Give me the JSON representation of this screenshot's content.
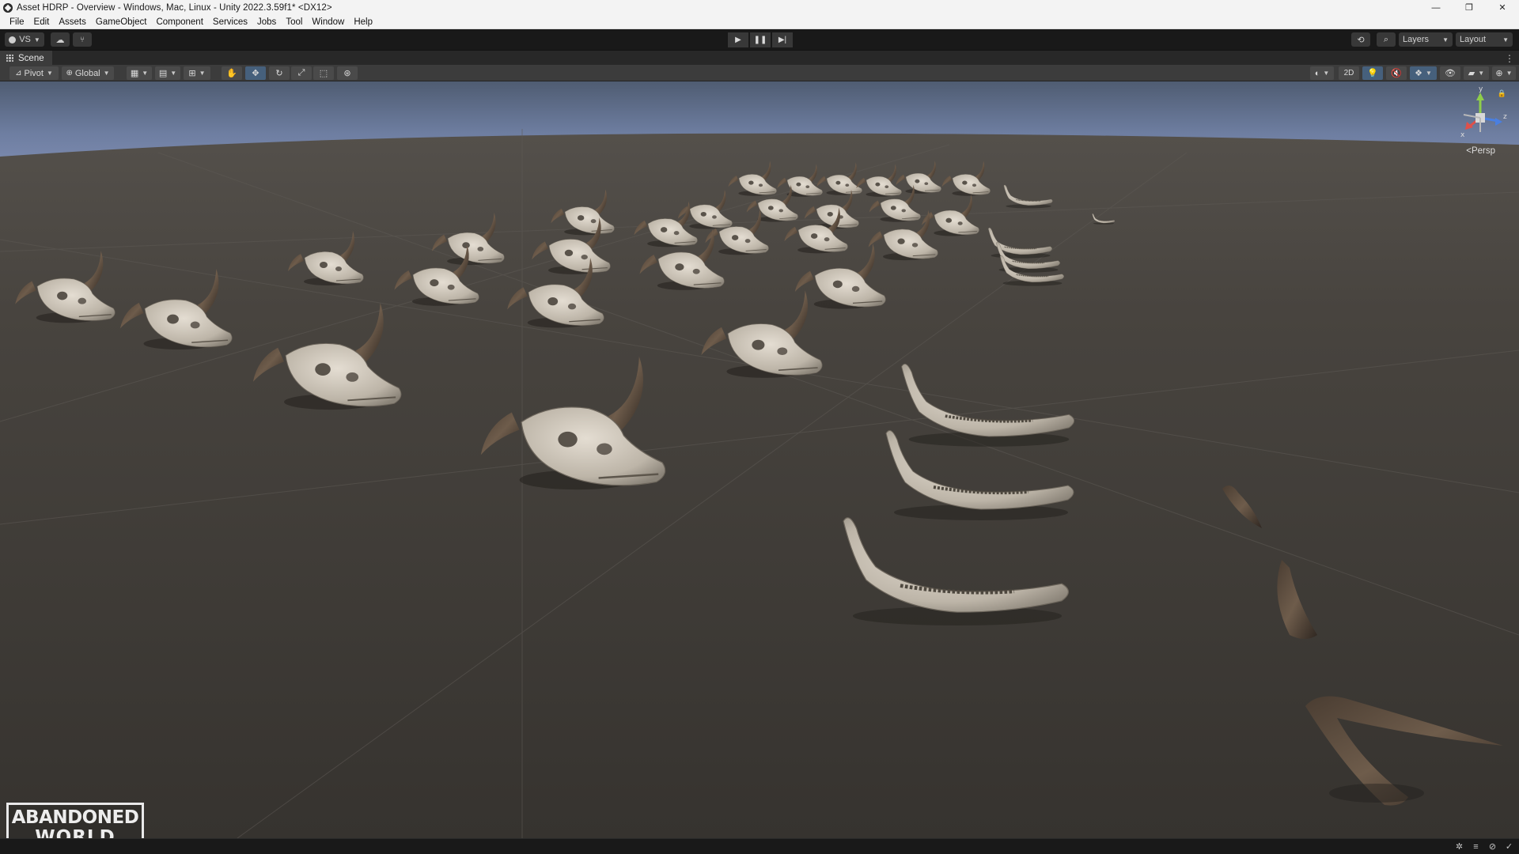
{
  "window": {
    "title": "Asset HDRP - Overview - Windows, Mac, Linux - Unity 2022.3.59f1* <DX12>",
    "controls": [
      "—",
      "❐",
      "✕"
    ]
  },
  "menu": [
    "File",
    "Edit",
    "Assets",
    "GameObject",
    "Component",
    "Services",
    "Jobs",
    "Tool",
    "Window",
    "Help"
  ],
  "toolbar": {
    "account_label": "VS",
    "layers_label": "Layers",
    "layout_label": "Layout"
  },
  "scene_tab": {
    "label": "Scene"
  },
  "scene_toolbar": {
    "pivot_label": "Pivot",
    "global_label": "Global",
    "mode_2d_label": "2D"
  },
  "viewport": {
    "projection_label": "Persp",
    "gizmo_axes": {
      "x": "x",
      "y": "y",
      "z": "z"
    },
    "logo_line1": "ABANDONED",
    "logo_line2": "WORLD"
  },
  "colors": {
    "scene_active_button": "#46607c",
    "gizmo_x": "#e0504a",
    "gizmo_y": "#8fce4a",
    "gizmo_z": "#4a7fe0"
  }
}
